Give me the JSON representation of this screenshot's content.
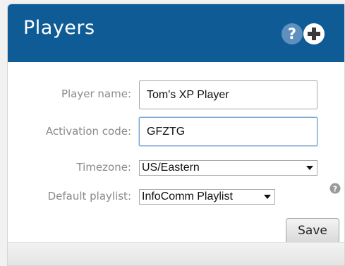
{
  "header": {
    "title": "Players",
    "help_icon": "help-circle-icon",
    "add_icon": "plus-circle-icon",
    "color": "#0f5b96"
  },
  "form": {
    "player_name": {
      "label": "Player name:",
      "value": "Tom's XP Player"
    },
    "activation_code": {
      "label": "Activation code:",
      "value": "GFZTG"
    },
    "timezone": {
      "label": "Timezone:",
      "selected": "US/Eastern"
    },
    "default_playlist": {
      "label": "Default playlist:",
      "selected": "InfoComm Playlist",
      "help_icon": "help-circle-icon"
    }
  },
  "actions": {
    "save_label": "Save"
  }
}
